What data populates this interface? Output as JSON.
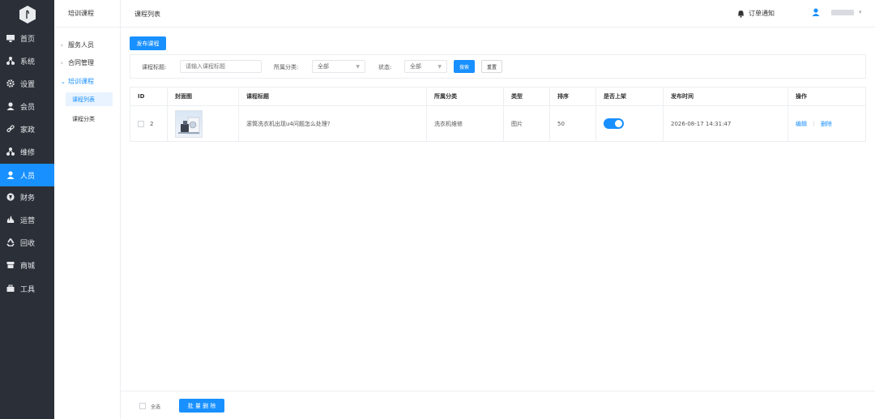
{
  "sidebar": {
    "items": [
      {
        "label": "首页",
        "icon": "monitor-icon"
      },
      {
        "label": "系统",
        "icon": "org-icon"
      },
      {
        "label": "设置",
        "icon": "gear-icon"
      },
      {
        "label": "会员",
        "icon": "user-icon"
      },
      {
        "label": "家政",
        "icon": "link-icon"
      },
      {
        "label": "维修",
        "icon": "org-icon"
      },
      {
        "label": "人员",
        "icon": "user-icon",
        "active": true
      },
      {
        "label": "财务",
        "icon": "coin-icon"
      },
      {
        "label": "运营",
        "icon": "fire-icon"
      },
      {
        "label": "回收",
        "icon": "recycle-icon"
      },
      {
        "label": "商城",
        "icon": "shop-icon"
      },
      {
        "label": "工具",
        "icon": "toolbox-icon"
      }
    ]
  },
  "subnav": {
    "title": "培训课程",
    "items": [
      {
        "label": "服务人员"
      },
      {
        "label": "合同管理"
      },
      {
        "label": "培训课程",
        "open": true
      }
    ],
    "children": [
      {
        "label": "课程列表",
        "active": true
      },
      {
        "label": "课程分类"
      }
    ]
  },
  "header": {
    "title": "课程列表",
    "notice": "订单通知"
  },
  "toolbar": {
    "publish": "发布课程"
  },
  "filter": {
    "title_label": "课程标题:",
    "title_placeholder": "请输入课程标题",
    "category_label": "所属分类:",
    "category_value": "全部",
    "status_label": "状态:",
    "status_value": "全部",
    "search": "搜索",
    "reset": "重置"
  },
  "table": {
    "columns": [
      "ID",
      "封面图",
      "课程标题",
      "所属分类",
      "类型",
      "排序",
      "是否上架",
      "发布时间",
      "操作"
    ],
    "rows": [
      {
        "id": "2",
        "title": "滚筒洗衣机出现u4问题怎么处理?",
        "category": "洗衣机维修",
        "type": "图片",
        "sort": "50",
        "on_shelf": true,
        "published": "2026-08-17 14:31:47",
        "edit": "编辑",
        "delete": "删除"
      }
    ]
  },
  "footer": {
    "select_all": "全选",
    "batch_delete": "批 量 删 除"
  },
  "colors": {
    "primary": "#1890ff",
    "sidebar_bg": "#2b3038"
  }
}
